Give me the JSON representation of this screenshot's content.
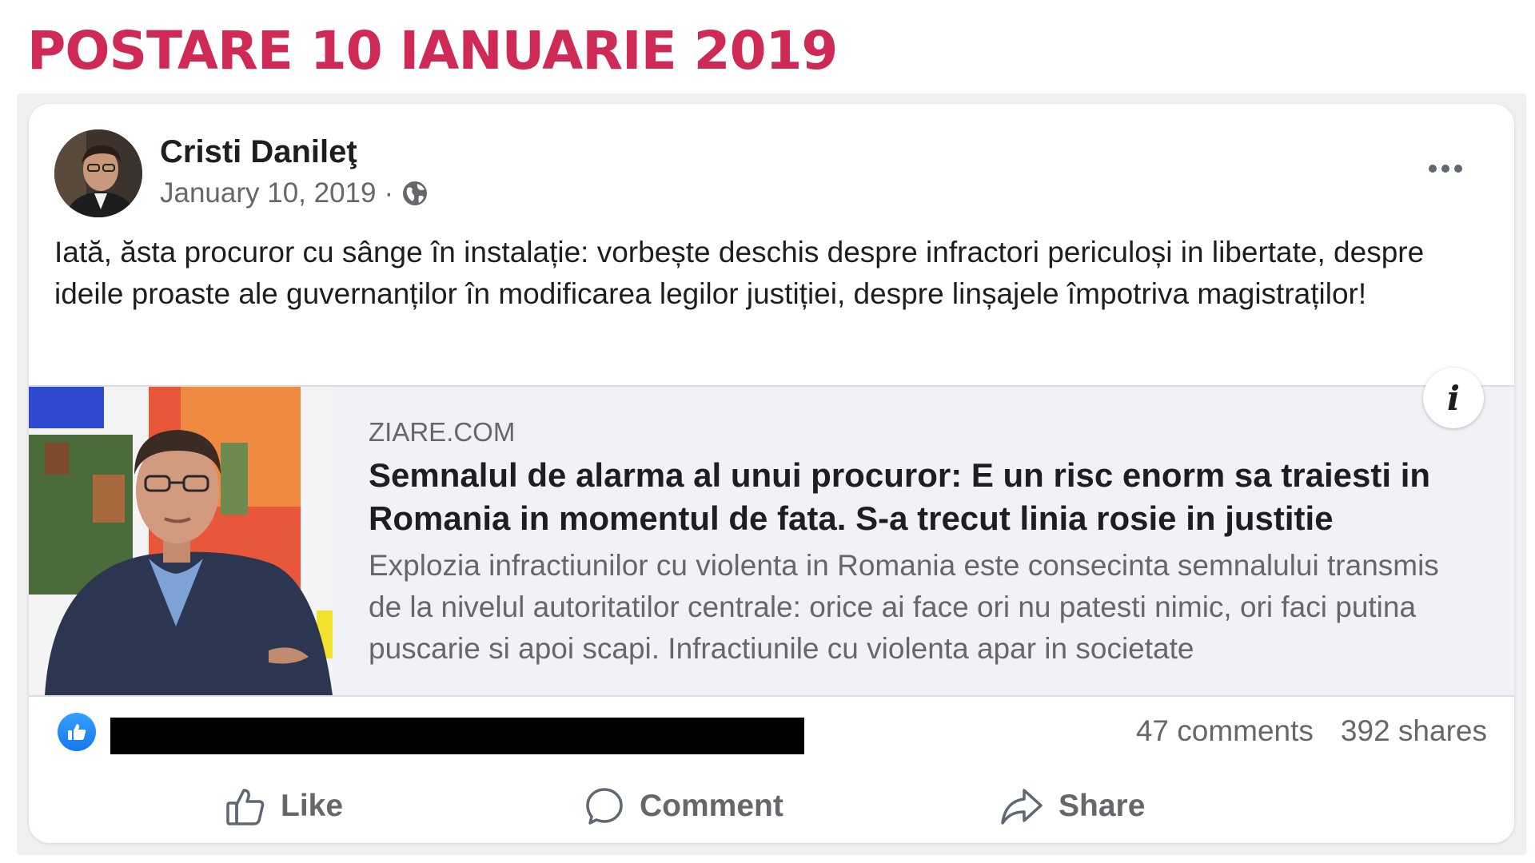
{
  "headline": "POSTARE 10 IANUARIE 2019",
  "post": {
    "author": "Cristi Danileţ",
    "date": "January 10, 2019",
    "separator": "·",
    "privacy_icon": "globe-icon",
    "text": "Iată, ăsta procuror cu sânge în instalație: vorbește deschis despre infractori periculoși in libertate, despre ideile proaste ale guvernanților în modificarea legilor justiției, despre linșajele împotriva magistraților!"
  },
  "link_preview": {
    "domain": "ZIARE.COM",
    "title": "Semnalul de alarma al unui procuror: E un risc enorm sa traiesti in Romania in momentul de fata. S-a trecut linia rosie in justitie",
    "description": "Explozia infractiunilor cu violenta in Romania este consecinta semnalului transmis de la nivelul autoritatilor centrale: orice ai face ori nu patesti nimic, ori faci putina puscarie si apoi scapi. Infractiunile cu violenta apar in societate",
    "info_label": "i"
  },
  "stats": {
    "comments": "47 comments",
    "shares": "392 shares"
  },
  "actions": {
    "like": "Like",
    "comment": "Comment",
    "share": "Share"
  },
  "colors": {
    "headline": "#cf2a56",
    "facebook_blue": "#1877f2",
    "secondary_text": "#65676b"
  }
}
